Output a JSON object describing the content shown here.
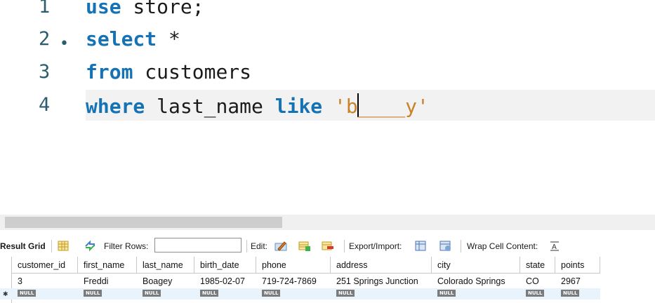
{
  "editor": {
    "lines": [
      {
        "num": "1",
        "parts": [
          {
            "t": "use",
            "kw": true
          },
          {
            "t": " store;"
          }
        ]
      },
      {
        "num": "2",
        "parts": [
          {
            "t": "select",
            "kw": true
          },
          {
            "t": " *"
          }
        ]
      },
      {
        "num": "3",
        "parts": [
          {
            "t": "from",
            "kw": true
          },
          {
            "t": " customers"
          }
        ]
      },
      {
        "num": "4",
        "parts": [
          {
            "t": "where",
            "kw": true
          },
          {
            "t": " last_name "
          },
          {
            "t": "like",
            "kw": true
          },
          {
            "t": " "
          }
        ]
      }
    ],
    "line4_str_before_cursor": "'b",
    "line4_str_after_cursor": "____y'",
    "fold_marker": "•"
  },
  "toolbar": {
    "result_grid": "Result Grid",
    "filter_rows": "Filter Rows:",
    "filter_value": "",
    "edit": "Edit:",
    "export_import": "Export/Import:",
    "wrap_cell": "Wrap Cell Content:",
    "colors": {
      "grid_icon": "#e0b93a",
      "refresh_icon": "#3a7fd0",
      "edit_icon": "#e07b1f",
      "add_icon": "#3bb24a",
      "del_icon": "#d9352b",
      "save_icon": "#4a73b8"
    }
  },
  "grid": {
    "columns": [
      "customer_id",
      "first_name",
      "last_name",
      "birth_date",
      "phone",
      "address",
      "city",
      "state",
      "points"
    ],
    "rows": [
      [
        "3",
        "Freddi",
        "Boagey",
        "1985-02-07",
        "719-724-7869",
        "251 Springs Junction",
        "Colorado Springs",
        "CO",
        "2967"
      ]
    ],
    "null_label": "NULL"
  }
}
